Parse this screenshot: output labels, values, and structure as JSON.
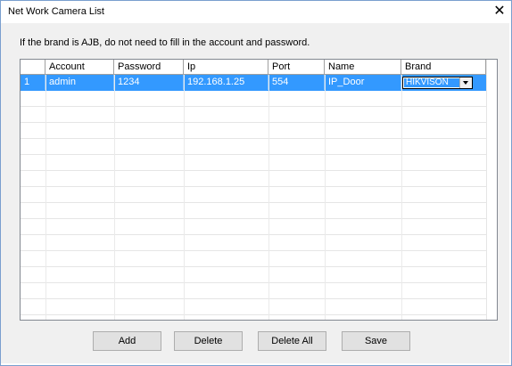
{
  "window": {
    "title": "Net Work Camera List",
    "close_glyph": "✕"
  },
  "hint": "If the brand is AJB, do not need to fill in the account and password.",
  "table": {
    "columns": [
      "",
      "Account",
      "Password",
      "Ip",
      "Port",
      "Name",
      "Brand"
    ],
    "rows": [
      {
        "index": "1",
        "account": "admin",
        "password": "1234",
        "ip": "192.168.1.25",
        "port": "554",
        "name": "IP_Door",
        "brand": "HIKVISON"
      }
    ]
  },
  "buttons": {
    "add": "Add",
    "delete": "Delete",
    "delete_all": "Delete All",
    "save": "Save"
  },
  "colors": {
    "selection": "#3399ff",
    "accent_border": "#7a9fcf"
  }
}
